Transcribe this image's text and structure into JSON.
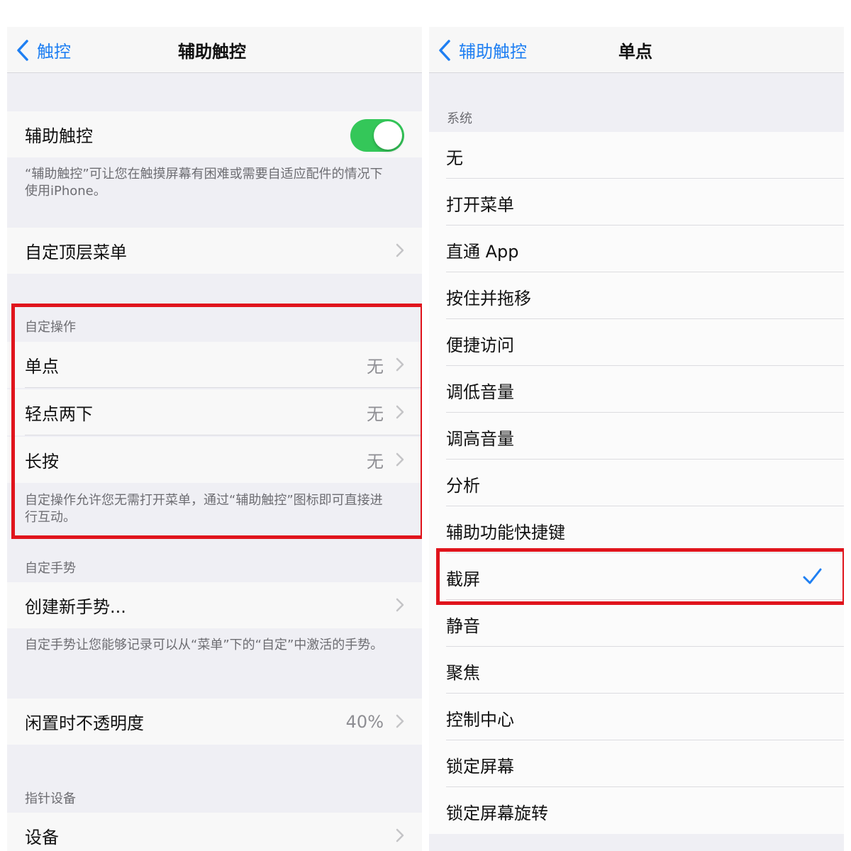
{
  "left": {
    "nav": {
      "back_label": "触控",
      "title": "辅助触控"
    },
    "assistive_touch": {
      "label": "辅助触控",
      "enabled": true
    },
    "assistive_touch_note": "“辅助触控”可让您在触摸屏幕有困难或需要自适应配件的情况下使用iPhone。",
    "customize_menu": {
      "label": "自定顶层菜单"
    },
    "custom_actions": {
      "header": "自定操作",
      "items": [
        {
          "label": "单点",
          "value": "无"
        },
        {
          "label": "轻点两下",
          "value": "无"
        },
        {
          "label": "长按",
          "value": "无"
        }
      ],
      "note": "自定操作允许您无需打开菜单，通过“辅助触控”图标即可直接进行互动。"
    },
    "custom_gestures": {
      "header": "自定手势",
      "create_label": "创建新手势...",
      "note": "自定手势让您能够记录可以从“菜单”下的“自定”中激活的手势。"
    },
    "idle_opacity": {
      "label": "闲置时不透明度",
      "value": "40%"
    },
    "pointer_devices": {
      "header": "指针设备",
      "devices_label": "设备"
    }
  },
  "right": {
    "nav": {
      "back_label": "辅助触控",
      "title": "单点"
    },
    "section_header": "系统",
    "items": [
      {
        "label": "无"
      },
      {
        "label": "打开菜单"
      },
      {
        "label": "直通 App"
      },
      {
        "label": "按住并拖移"
      },
      {
        "label": "便捷访问"
      },
      {
        "label": "调低音量"
      },
      {
        "label": "调高音量"
      },
      {
        "label": "分析"
      },
      {
        "label": "辅助功能快捷键"
      },
      {
        "label": "截屏"
      },
      {
        "label": "静音"
      },
      {
        "label": "聚焦"
      },
      {
        "label": "控制中心"
      },
      {
        "label": "锁定屏幕"
      },
      {
        "label": "锁定屏幕旋转"
      }
    ],
    "selected_item": "截屏"
  },
  "colors": {
    "accent": "#1f7ff2",
    "toggle_on": "#34c759",
    "highlight": "#e0141c"
  }
}
